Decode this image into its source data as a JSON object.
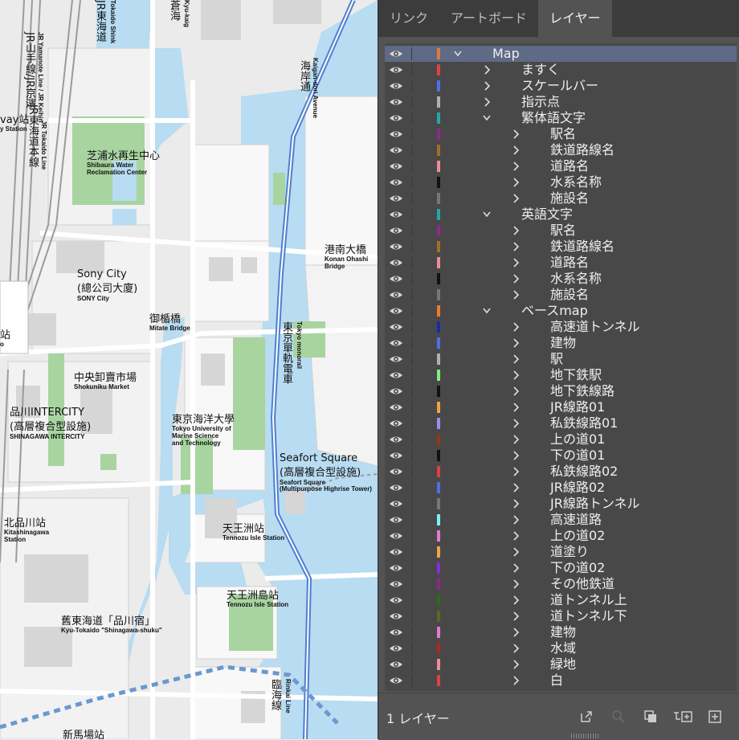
{
  "map": {
    "labels": [
      {
        "key": "shibaura",
        "ja": "芝浦水再生中心",
        "en1": "Shibaura Water",
        "en2": "Reclamation Center"
      },
      {
        "key": "sony",
        "ja": "Sony City",
        "ja2": "(總公司大廈)",
        "en1": "SONY City"
      },
      {
        "key": "mitate",
        "ja": "御楯橋",
        "en1": "Mitate Bridge"
      },
      {
        "key": "shokuniku",
        "ja": "中央卸賣市場",
        "en1": "Shokuniku Market"
      },
      {
        "key": "intercity",
        "ja": "品川INTERCITY",
        "ja2": "(高層複合型設施)",
        "en1": "SHINAGAWA INTERCITY"
      },
      {
        "key": "kaiyo",
        "ja": "東京海洋大學",
        "en1": "Tokyo University of",
        "en2": "Marine Science",
        "en3": "and Technology"
      },
      {
        "key": "seafort",
        "ja": "Seafort Square",
        "ja2": "(高層複合型設施)",
        "en1": "Seafort Square",
        "en2": "(Multipurpose Highrise Tower)"
      },
      {
        "key": "konan",
        "ja": "港南大橋",
        "en1": "Konan Ohashi",
        "en2": "Bridge"
      },
      {
        "key": "tennozu_mono",
        "ja": "天王洲站",
        "en1": "Tennozu Isle Station"
      },
      {
        "key": "tennozu_rinkai",
        "ja": "天王洲島站",
        "en1": "Tennozu Isle Station"
      },
      {
        "key": "kitashinagawa",
        "ja": "北品川站",
        "en1": "Kitashinagawa",
        "en2": "Station"
      },
      {
        "key": "kyu_tokaido",
        "ja": "舊東海道「品川宿」",
        "en1": "Kyu-Tokaido \"Shinagawa-shuku\""
      },
      {
        "key": "shinbanba",
        "ja": "新馬場站"
      },
      {
        "key": "way_station",
        "ja": "vay站",
        "en1": "y Station"
      },
      {
        "key": "station_cut",
        "ja": "站",
        "en1": "o"
      }
    ],
    "vertical": {
      "yamanote": "JR山手線/JR京濱",
      "yamanote_en": "JR Yamanote Line / JR Keihin",
      "jr_tokaido": "JR東海道",
      "jr_tokaido_en": "Tokaido Shink",
      "jr_tokaido_main": "JR東海道本線",
      "jr_tokaido_main_en": "JR Tokaido Line",
      "kaigan": "海岸通",
      "kaigan_en": "Kaigan-dori Avenue",
      "monorail": "東京單軌電車",
      "monorail_en": "Tokyo monorail",
      "rinkai": "臨海線",
      "rinkai_en": "Rinkai Line",
      "top1": "蒼海",
      "top1_en": "Kyu-kaig"
    }
  },
  "panel": {
    "tabs": [
      "リンク",
      "アートボード",
      "レイヤー"
    ],
    "active_tab": "レイヤー",
    "layers": [
      {
        "name": "Map",
        "level": 0,
        "expanded": true,
        "color": "#e07b39",
        "selected": true
      },
      {
        "name": "ますく",
        "level": 1,
        "expanded": false,
        "color": "#e0413f"
      },
      {
        "name": "スケールバー",
        "level": 1,
        "expanded": false,
        "color": "#4f6fe6"
      },
      {
        "name": "指示点",
        "level": 1,
        "expanded": false,
        "color": "#b0b0b0"
      },
      {
        "name": "繁体語文字",
        "level": 1,
        "expanded": true,
        "color": "#27a6a6"
      },
      {
        "name": "駅名",
        "level": 2,
        "expanded": false,
        "color": "#8a2a8a"
      },
      {
        "name": "鉄道路線名",
        "level": 2,
        "expanded": false,
        "color": "#a36d2a"
      },
      {
        "name": "道路名",
        "level": 2,
        "expanded": false,
        "color": "#f08a9a"
      },
      {
        "name": "水系名称",
        "level": 2,
        "expanded": false,
        "color": "#111111"
      },
      {
        "name": "施設名",
        "level": 2,
        "expanded": false,
        "color": "#777777"
      },
      {
        "name": "英語文字",
        "level": 1,
        "expanded": true,
        "color": "#27a6a6"
      },
      {
        "name": "駅名",
        "level": 2,
        "expanded": false,
        "color": "#8a2a8a"
      },
      {
        "name": "鉄道路線名",
        "level": 2,
        "expanded": false,
        "color": "#a36d2a"
      },
      {
        "name": "道路名",
        "level": 2,
        "expanded": false,
        "color": "#f08a9a"
      },
      {
        "name": "水系名称",
        "level": 2,
        "expanded": false,
        "color": "#111111"
      },
      {
        "name": "施設名",
        "level": 2,
        "expanded": false,
        "color": "#777777"
      },
      {
        "name": "ベースmap",
        "level": 1,
        "expanded": true,
        "color": "#f07a28"
      },
      {
        "name": "高速道トンネル",
        "level": 2,
        "expanded": false,
        "color": "#1c2aa8"
      },
      {
        "name": "建物",
        "level": 2,
        "expanded": false,
        "color": "#4f6fe6"
      },
      {
        "name": "駅",
        "level": 2,
        "expanded": false,
        "color": "#b0b0b0"
      },
      {
        "name": "地下鉄駅",
        "level": 2,
        "expanded": false,
        "color": "#7ef07e"
      },
      {
        "name": "地下鉄線路",
        "level": 2,
        "expanded": false,
        "color": "#111111"
      },
      {
        "name": "JR線路01",
        "level": 2,
        "expanded": false,
        "color": "#f0a24a"
      },
      {
        "name": "私鉄線路01",
        "level": 2,
        "expanded": false,
        "color": "#9a8ef0"
      },
      {
        "name": "上の道01",
        "level": 2,
        "expanded": false,
        "color": "#8a3a1a"
      },
      {
        "name": "下の道01",
        "level": 2,
        "expanded": false,
        "color": "#111111"
      },
      {
        "name": "私鉄線路02",
        "level": 2,
        "expanded": false,
        "color": "#e0413f"
      },
      {
        "name": "JR線路02",
        "level": 2,
        "expanded": false,
        "color": "#4f6fe6"
      },
      {
        "name": "JR線路トンネル",
        "level": 2,
        "expanded": false,
        "color": "#777777"
      },
      {
        "name": "高速道路",
        "level": 2,
        "expanded": false,
        "color": "#7ef0f0"
      },
      {
        "name": "上の道02",
        "level": 2,
        "expanded": false,
        "color": "#e07bd0"
      },
      {
        "name": "道塗り",
        "level": 2,
        "expanded": false,
        "color": "#f0a24a"
      },
      {
        "name": "下の道02",
        "level": 2,
        "expanded": false,
        "color": "#8a2ae0"
      },
      {
        "name": "その他鉄道",
        "level": 2,
        "expanded": false,
        "color": "#8a2a8a"
      },
      {
        "name": "道トンネル上",
        "level": 2,
        "expanded": false,
        "color": "#2a6a1a"
      },
      {
        "name": "道トンネル下",
        "level": 2,
        "expanded": false,
        "color": "#5a6a1a"
      },
      {
        "name": "建物",
        "level": 2,
        "expanded": false,
        "color": "#e07bd0"
      },
      {
        "name": "水域",
        "level": 2,
        "expanded": false,
        "color": "#a82a1a"
      },
      {
        "name": "緑地",
        "level": 2,
        "expanded": false,
        "color": "#f08a9a"
      },
      {
        "name": "白",
        "level": 2,
        "expanded": false,
        "color": "#e0413f"
      }
    ],
    "footer": {
      "layer_count": "1 レイヤー",
      "icons": [
        "collect-export-icon",
        "locate-object-icon",
        "make-clipping-mask-icon",
        "create-sublayer-icon",
        "new-layer-icon"
      ]
    }
  }
}
